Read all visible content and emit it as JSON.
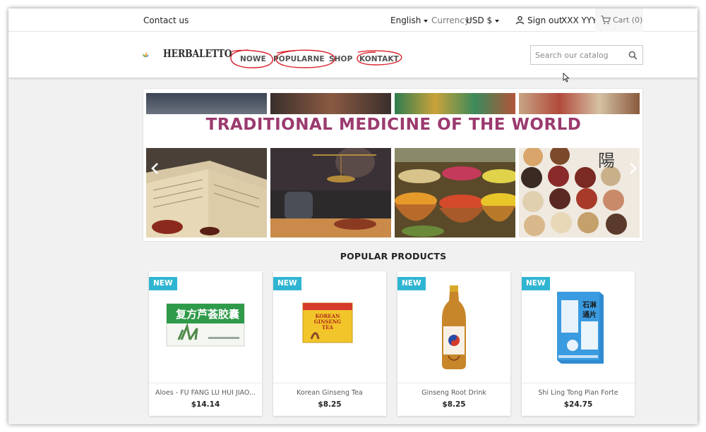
{
  "topbar": {
    "contact": "Contact us",
    "language": "English",
    "currency_label": "Currency:",
    "currency_value": "USD $",
    "sign_out": "Sign out",
    "username": "XXX YYY",
    "cart": "Cart (0)"
  },
  "header": {
    "logo_text": "HERBALETTO",
    "nav": [
      "NOWE",
      "POPULARNE",
      "SHOP",
      "KONTAKT"
    ],
    "search_placeholder": "Search our catalog"
  },
  "banner": {
    "title": "TRADITIONAL MEDICINE OF THE WORLD"
  },
  "products": {
    "section_title": "POPULAR PRODUCTS",
    "items": [
      {
        "badge": "NEW",
        "name": "Aloes - FU FANG LU HUI JIAO...",
        "price": "$14.14"
      },
      {
        "badge": "NEW",
        "name": "Korean Ginseng Tea",
        "price": "$8.25"
      },
      {
        "badge": "NEW",
        "name": "Ginseng Root Drink",
        "price": "$8.25"
      },
      {
        "badge": "NEW",
        "name": "Shi Ling Tong Pian Forte",
        "price": "$24.75"
      }
    ]
  },
  "colors": {
    "badge": "#2fb5d2",
    "banner_title": "#9b3a6e",
    "annotation": "#d9232e"
  }
}
